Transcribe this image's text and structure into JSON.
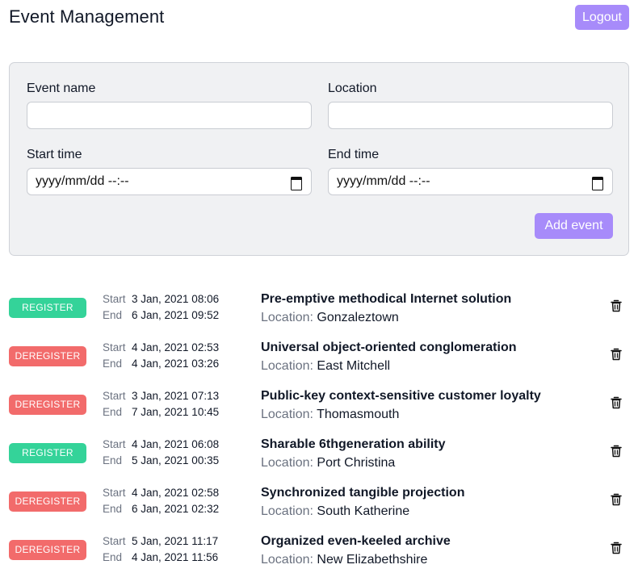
{
  "header": {
    "title": "Event Management",
    "logout_label": "Logout"
  },
  "form": {
    "event_name_label": "Event name",
    "event_name_value": "",
    "location_label": "Location",
    "location_value": "",
    "start_time_label": "Start time",
    "start_time_placeholder": "yyyy/mm/dd --:--",
    "end_time_label": "End time",
    "end_time_placeholder": "yyyy/mm/dd --:--",
    "add_label": "Add event"
  },
  "labels": {
    "start": "Start",
    "end": "End",
    "location_prefix": "Location:"
  },
  "colors": {
    "accent": "#a78bfa",
    "register": "#34d399",
    "deregister": "#f26b6b"
  },
  "events": [
    {
      "action": "REGISTER",
      "start": "3 Jan, 2021 08:06",
      "end": "6 Jan, 2021 09:52",
      "name": "Pre-emptive methodical Internet solution",
      "location": "Gonzaleztown"
    },
    {
      "action": "DEREGISTER",
      "start": "4 Jan, 2021 02:53",
      "end": "4 Jan, 2021 03:26",
      "name": "Universal object-oriented conglomeration",
      "location": "East Mitchell"
    },
    {
      "action": "DEREGISTER",
      "start": "3 Jan, 2021 07:13",
      "end": "7 Jan, 2021 10:45",
      "name": "Public-key context-sensitive customer loyalty",
      "location": "Thomasmouth"
    },
    {
      "action": "REGISTER",
      "start": "4 Jan, 2021 06:08",
      "end": "5 Jan, 2021 00:35",
      "name": "Sharable 6thgeneration ability",
      "location": "Port Christina"
    },
    {
      "action": "DEREGISTER",
      "start": "4 Jan, 2021 02:58",
      "end": "6 Jan, 2021 02:32",
      "name": "Synchronized tangible projection",
      "location": "South Katherine"
    },
    {
      "action": "DEREGISTER",
      "start": "5 Jan, 2021 11:17",
      "end": "4 Jan, 2021 11:56",
      "name": "Organized even-keeled archive",
      "location": "New Elizabethshire"
    }
  ],
  "icons": {
    "delete": "trash-icon",
    "calendar": "calendar-icon"
  }
}
